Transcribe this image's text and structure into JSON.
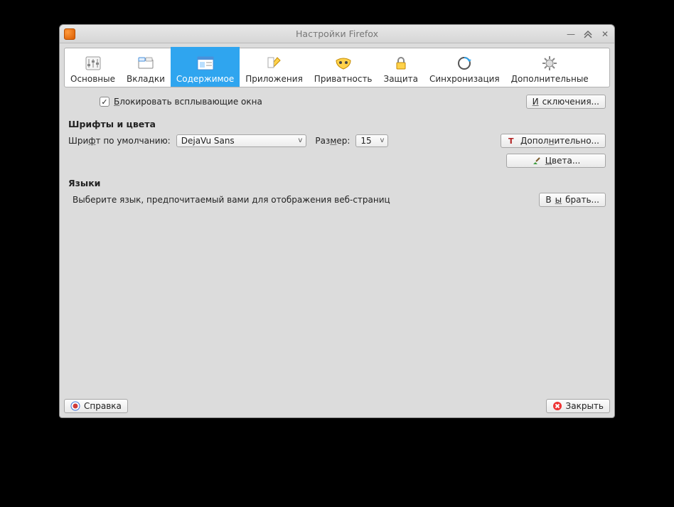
{
  "window": {
    "title": "Настройки Firefox"
  },
  "tabs": [
    {
      "label": "Основные"
    },
    {
      "label": "Вкладки"
    },
    {
      "label": "Содержимое"
    },
    {
      "label": "Приложения"
    },
    {
      "label": "Приватность"
    },
    {
      "label": "Защита"
    },
    {
      "label": "Синхронизация"
    },
    {
      "label": "Дополнительные"
    }
  ],
  "popup": {
    "block_label_underline_char": "Б",
    "block_label_rest": "локировать всплывающие окна",
    "exceptions_underline_char": "И",
    "exceptions_rest": "сключения..."
  },
  "fonts": {
    "section": "Шрифты и цвета",
    "default_label_pre": "Шри",
    "default_label_u": "ф",
    "default_label_post": "т по умолчанию:",
    "font_value": "DejaVu Sans",
    "size_label_pre": "Раз",
    "size_label_u": "м",
    "size_label_post": "ер:",
    "size_value": "15",
    "advanced_pre": "Допол",
    "advanced_u": "н",
    "advanced_post": "ительно...",
    "colors_u": "Ц",
    "colors_rest": "вета..."
  },
  "langs": {
    "section": "Языки",
    "desc": "Выберите язык, предпочитаемый вами для отображения веб-страниц",
    "choose_pre": "В",
    "choose_u": "ы",
    "choose_post": "брать..."
  },
  "footer": {
    "help": "Справка",
    "close": "Закрыть"
  }
}
